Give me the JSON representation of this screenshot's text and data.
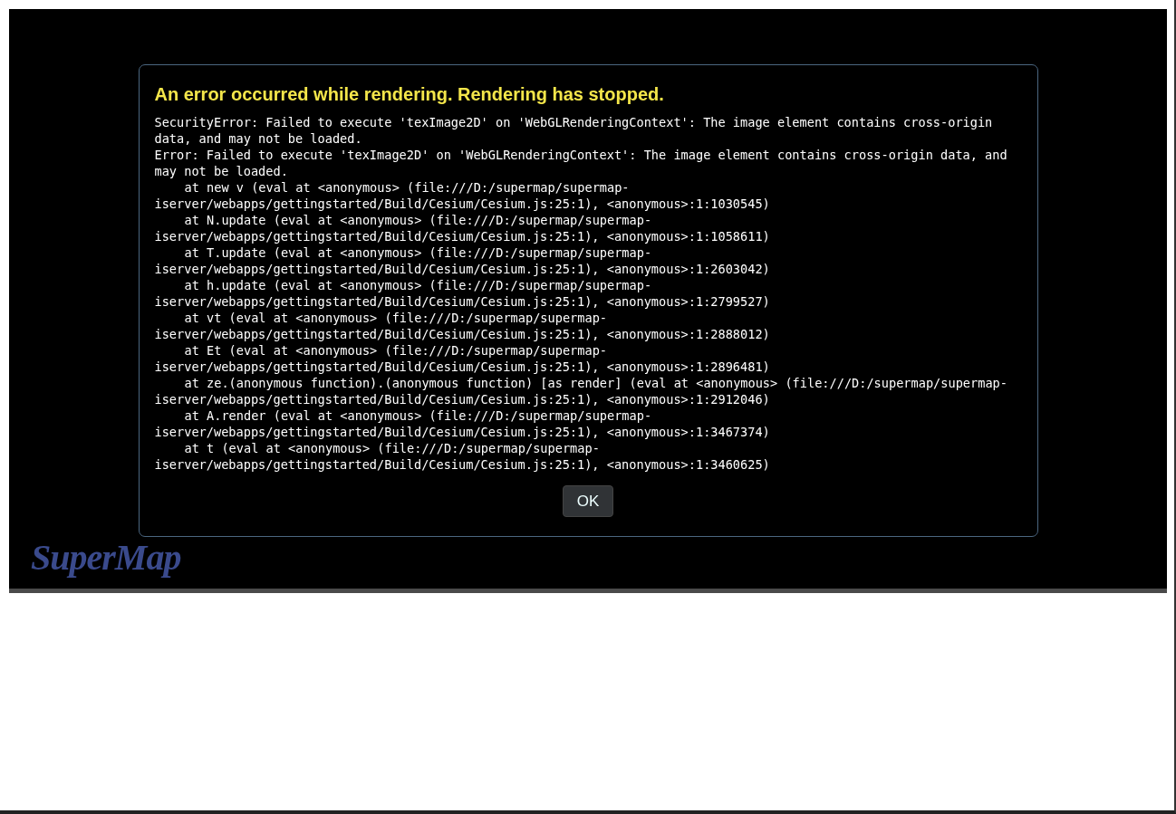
{
  "logo": "SuperMap",
  "dialog": {
    "title": "An error occurred while rendering. Rendering has stopped.",
    "lines": [
      {
        "kind": "message",
        "text": "SecurityError: Failed to execute 'texImage2D' on 'WebGLRenderingContext': The image element contains cross-origin"
      },
      {
        "kind": "message",
        "text": "data, and may not be loaded."
      },
      {
        "kind": "message",
        "text": "Error: Failed to execute 'texImage2D' on 'WebGLRenderingContext': The image element contains cross-origin data, and"
      },
      {
        "kind": "message",
        "text": "may not be loaded."
      },
      {
        "kind": "frame",
        "text": "at new v (eval at <anonymous> (file:///D:/supermap/supermap-"
      },
      {
        "kind": "message",
        "text": "iserver/webapps/gettingstarted/Build/Cesium/Cesium.js:25:1), <anonymous>:1:1030545)"
      },
      {
        "kind": "frame",
        "text": "at N.update (eval at <anonymous> (file:///D:/supermap/supermap-"
      },
      {
        "kind": "message",
        "text": "iserver/webapps/gettingstarted/Build/Cesium/Cesium.js:25:1), <anonymous>:1:1058611)"
      },
      {
        "kind": "frame",
        "text": "at T.update (eval at <anonymous> (file:///D:/supermap/supermap-"
      },
      {
        "kind": "message",
        "text": "iserver/webapps/gettingstarted/Build/Cesium/Cesium.js:25:1), <anonymous>:1:2603042)"
      },
      {
        "kind": "frame",
        "text": "at h.update (eval at <anonymous> (file:///D:/supermap/supermap-"
      },
      {
        "kind": "message",
        "text": "iserver/webapps/gettingstarted/Build/Cesium/Cesium.js:25:1), <anonymous>:1:2799527)"
      },
      {
        "kind": "frame",
        "text": "at vt (eval at <anonymous> (file:///D:/supermap/supermap-"
      },
      {
        "kind": "message",
        "text": "iserver/webapps/gettingstarted/Build/Cesium/Cesium.js:25:1), <anonymous>:1:2888012)"
      },
      {
        "kind": "frame",
        "text": "at Et (eval at <anonymous> (file:///D:/supermap/supermap-"
      },
      {
        "kind": "message",
        "text": "iserver/webapps/gettingstarted/Build/Cesium/Cesium.js:25:1), <anonymous>:1:2896481)"
      },
      {
        "kind": "frame",
        "text": "at ze.(anonymous function).(anonymous function) [as render] (eval at <anonymous> (file:///D:/supermap/supermap-"
      },
      {
        "kind": "message",
        "text": "iserver/webapps/gettingstarted/Build/Cesium/Cesium.js:25:1), <anonymous>:1:2912046)"
      },
      {
        "kind": "frame",
        "text": "at A.render (eval at <anonymous> (file:///D:/supermap/supermap-"
      },
      {
        "kind": "message",
        "text": "iserver/webapps/gettingstarted/Build/Cesium/Cesium.js:25:1), <anonymous>:1:3467374)"
      },
      {
        "kind": "frame",
        "text": "at t (eval at <anonymous> (file:///D:/supermap/supermap-"
      },
      {
        "kind": "message",
        "text": "iserver/webapps/gettingstarted/Build/Cesium/Cesium.js:25:1), <anonymous>:1:3460625)"
      }
    ],
    "button": "OK"
  }
}
